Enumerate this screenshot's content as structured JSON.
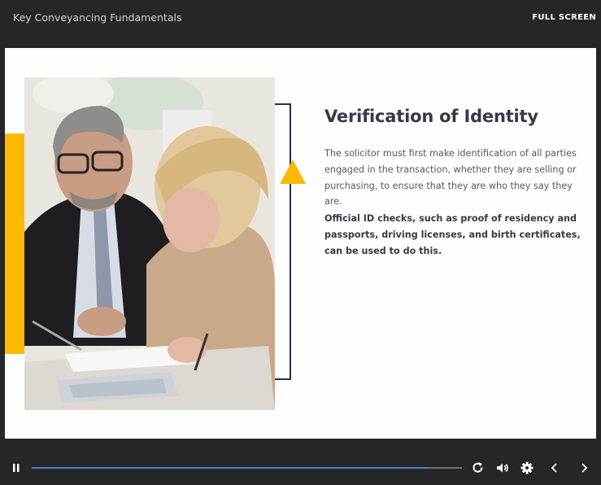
{
  "header": {
    "course_title": "Key Conveyancing Fundamentals",
    "fullscreen_label": "FULL SCREEN"
  },
  "slide": {
    "heading": "Verification of Identity",
    "body": "The solicitor must first make identification of all parties engaged in the transaction, whether they are selling or purchasing, to ensure that they are who they say they are.",
    "bold_body": "Official ID checks, such as proof of residency and passports, driving licenses, and birth certificates, can be used to do this.",
    "image_alt": "photo of a solicitor and client reviewing documents",
    "accent_color": "#fbb901",
    "bracket_color": "#1f3447"
  },
  "player": {
    "progress": 0.92,
    "progress_color": "#4a7fd6",
    "icons": [
      "pause-icon",
      "replay-icon",
      "volume-icon",
      "gear-icon",
      "chevron-left-icon",
      "chevron-right-icon"
    ]
  }
}
